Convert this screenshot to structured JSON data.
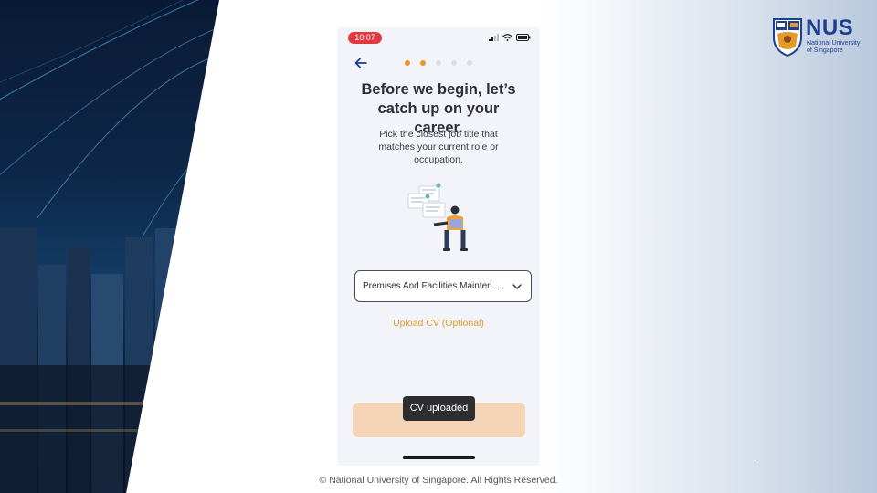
{
  "status_bar": {
    "time": "10:07"
  },
  "progress": {
    "total_steps": 5,
    "current_step": 2
  },
  "screen": {
    "title": "Before we begin, let’s catch up on your career.",
    "subtitle": "Pick the closest job title that matches your current role or occupation.",
    "job_title_select": {
      "selected_value": "Premises And Facilities Mainten..."
    },
    "upload_cv_link": "Upload CV (Optional)",
    "toast": "CV uploaded"
  },
  "branding": {
    "logo_text": "NUS",
    "logo_subtext": "National University of Singapore",
    "footer": "©  National University of Singapore. All Rights Reserved."
  },
  "colors": {
    "accent": "#e39a2a",
    "time_pill": "#e0393e",
    "cta_disabled": "#f3d4b6",
    "nus_blue": "#1c3f8f"
  }
}
